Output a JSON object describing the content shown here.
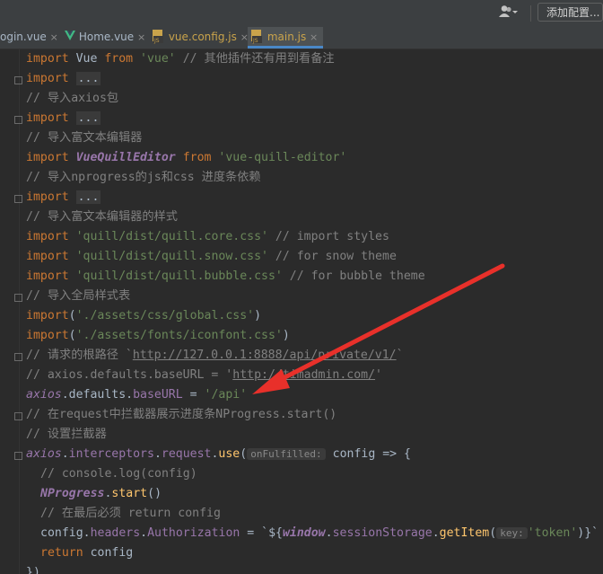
{
  "toolbar": {
    "user_icon": "user-dropdown-icon",
    "config_button": "添加配置..."
  },
  "tabs": [
    {
      "label": "ogin.vue",
      "icon": "vue-icon",
      "active": false
    },
    {
      "label": "Home.vue",
      "icon": "vue-icon",
      "active": false
    },
    {
      "label": "vue.config.js",
      "icon": "js-file-icon",
      "active": false
    },
    {
      "label": "main.js",
      "icon": "js-file-icon",
      "active": true
    }
  ],
  "tab_close": "×",
  "code": {
    "l1_kw": "import",
    "l1_a": " Vue ",
    "l1_from": "from",
    "l1_str": " 'vue'",
    "l1_cm": " // 其他插件还有用到看备注",
    "l2_kw": "import",
    "l2_fold": "...",
    "l3_cm": "// 导入axios包",
    "l4_kw": "import",
    "l4_fold": "...",
    "l5_cm": "// 导入富文本编辑器",
    "l6_kw": "import",
    "l6_name": "VueQuillEditor",
    "l6_from": "from",
    "l6_str": "'vue-quill-editor'",
    "l7_cm": "// 导入nprogress的js和css 进度条依赖",
    "l8_kw": "import",
    "l8_fold": "...",
    "l9_cm": "// 导入富文本编辑器的样式",
    "l10_kw": "import",
    "l10_str": "'quill/dist/quill.core.css'",
    "l10_cm": " // import styles",
    "l11_kw": "import",
    "l11_str": "'quill/dist/quill.snow.css'",
    "l11_cm": " // for snow theme",
    "l12_kw": "import",
    "l12_str": "'quill/dist/quill.bubble.css'",
    "l12_cm": " // for bubble theme",
    "l13_cm": "// 导入全局样式表",
    "l14_kw": "import",
    "l14_str": "'./assets/css/global.css'",
    "l15_kw": "import",
    "l15_str": "'./assets/fonts/iconfont.css'",
    "l16_cm": "// 请求的根路径 `",
    "l16_url": "http://127.0.0.1:8888/api/private/v1/",
    "l16_end": "`",
    "l17_cm": "// axios.defaults.baseURL = '",
    "l17_url": "http://timadmin.com/",
    "l17_end": "'",
    "l18_axios": "axios",
    "l18_a": ".defaults.",
    "l18_prop": "baseURL",
    "l18_eq": " = ",
    "l18_str": "'/api'",
    "l19_cm": "// 在request中拦截器展示进度条NProgress.start()",
    "l20_cm": "// 设置拦截器",
    "l21_axios": "axios",
    "l21_a": ".",
    "l21_prop1": "interceptors",
    "l21_b": ".",
    "l21_prop2": "request",
    "l21_c": ".",
    "l21_fn": "use",
    "l21_d": "(",
    "l21_hint": "onFulfilled:",
    "l21_e": " config => {",
    "l22_cm": "// console.log(config)",
    "l23_np": "NProgress",
    "l23_a": ".",
    "l23_fn": "start",
    "l23_b": "()",
    "l24_cm": "// 在最后必须 return config",
    "l25_a": "config.",
    "l25_p1": "headers",
    "l25_b": ".",
    "l25_p2": "Authorization",
    "l25_c": " = `${",
    "l25_win": "window",
    "l25_d": ".",
    "l25_p3": "sessionStorage",
    "l25_e": ".",
    "l25_fn": "getItem",
    "l25_f": "(",
    "l25_hint": "key:",
    "l25_str": "'token'",
    "l25_g": ")}`",
    "l26_kw": "return",
    "l26_a": " config",
    "l27_a": "})"
  },
  "colors": {
    "arrow": "#e8302a",
    "background": "#2b2b2b",
    "keyword": "#cc7832",
    "string": "#6a8759",
    "comment": "#808080"
  },
  "annotation": {
    "arrow_icon": "red-arrow-icon"
  }
}
